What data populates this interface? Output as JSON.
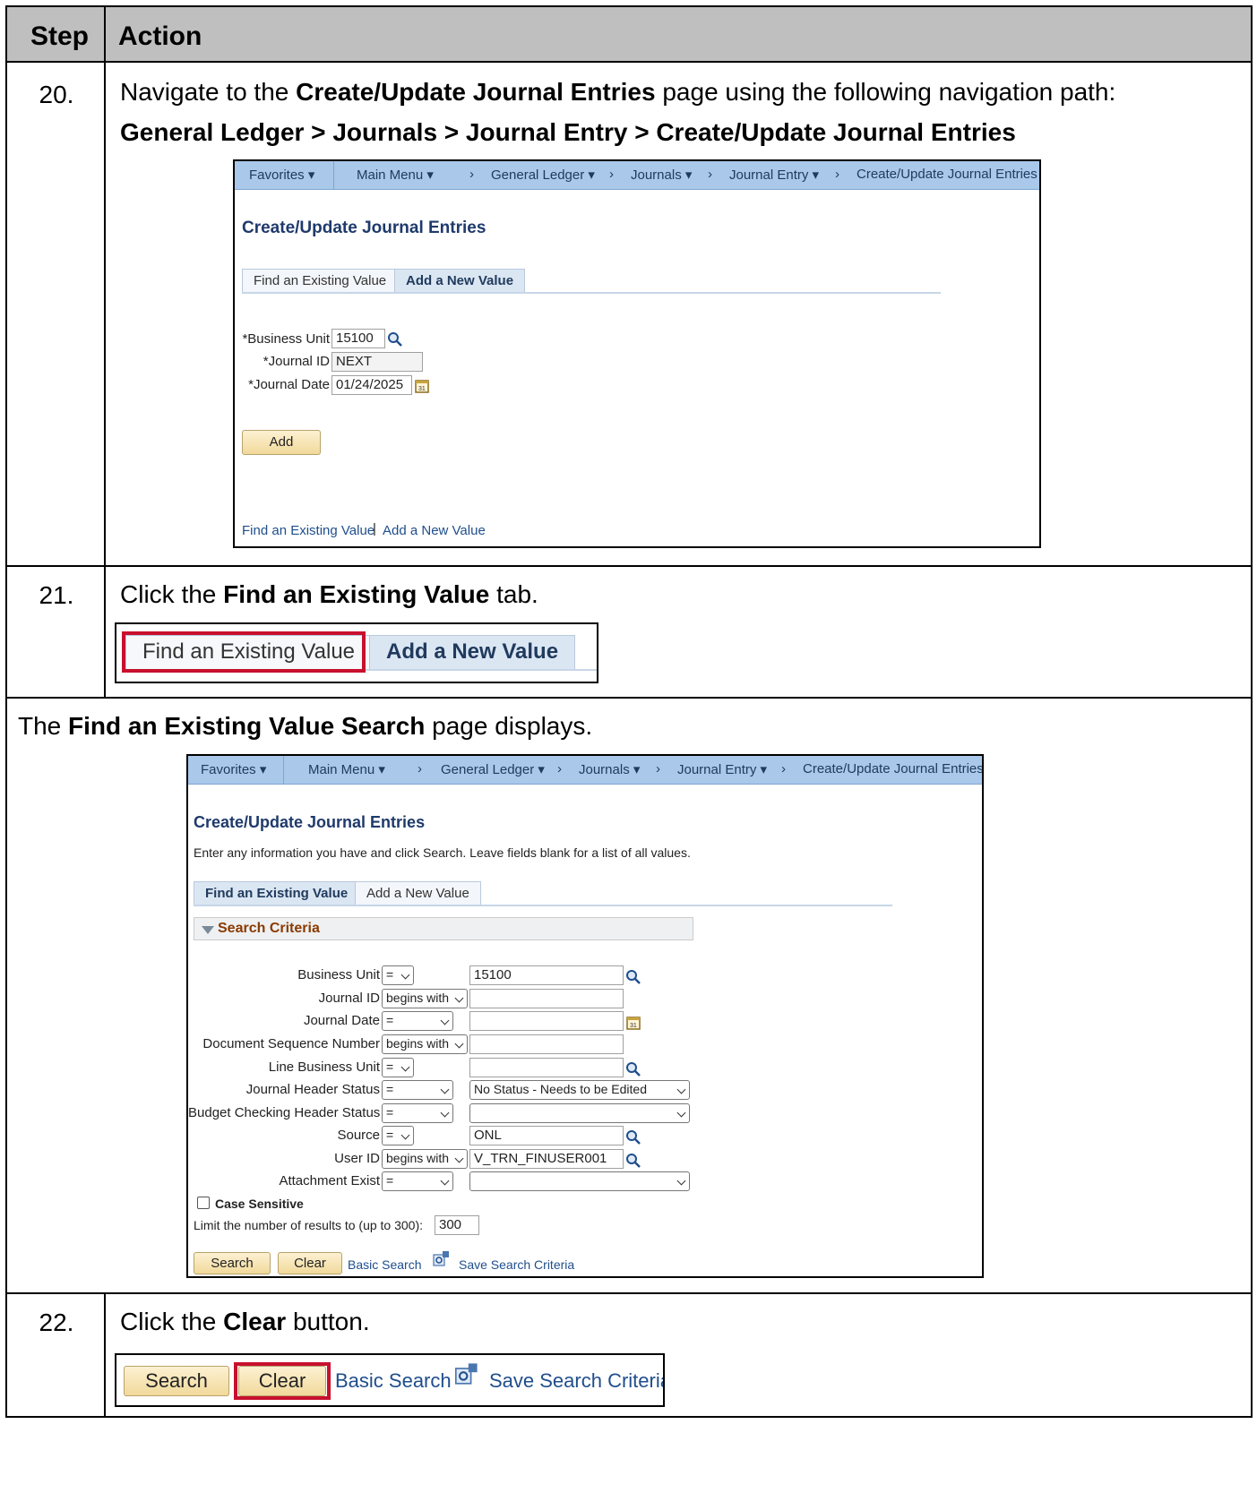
{
  "table_header": {
    "step": "Step",
    "action": "Action"
  },
  "nav": {
    "favorites": "Favorites",
    "main_menu": "Main Menu",
    "general_ledger": "General Ledger",
    "journals": "Journals",
    "journal_entry": "Journal Entry",
    "page": "Create/Update Journal Entries",
    "sep": ">"
  },
  "step20": {
    "num": "20.",
    "t1": "Navigate to the ",
    "b1": "Create/Update Journal Entries",
    "t2": " page using the following navigation path:",
    "path": "General Ledger > Journals > Journal Entry > Create/Update Journal Entries",
    "page_title": "Create/Update Journal Entries",
    "tab_find": "Find an Existing Value",
    "tab_add": "Add a New Value",
    "bu_label": "*Business Unit",
    "bu_value": "15100",
    "jid_label": "*Journal ID",
    "jid_value": "NEXT",
    "jdate_label": "*Journal Date",
    "jdate_value": "01/24/2025",
    "add_button": "Add",
    "link_find": "Find an Existing Value",
    "link_sep": "|",
    "link_add": "Add a New Value"
  },
  "step21": {
    "num": "21.",
    "t1": "Click the ",
    "b1": "Find an Existing Value",
    "t2": " tab.",
    "tab_find": "Find an Existing Value",
    "tab_add": "Add a New Value"
  },
  "note": {
    "t1": "The ",
    "b1": "Find an Existing Value Search",
    "t2": " page displays."
  },
  "search_page": {
    "title": "Create/Update Journal Entries",
    "instructions": "Enter any information you have and click Search. Leave fields blank for a list of all values.",
    "tab_find": "Find an Existing Value",
    "tab_add": "Add a New Value",
    "criteria_header": "Search Criteria",
    "fields": [
      {
        "label": "Business Unit",
        "op": "=",
        "value": "15100"
      },
      {
        "label": "Journal ID",
        "op": "begins with",
        "value": ""
      },
      {
        "label": "Journal Date",
        "op": "=",
        "value": ""
      },
      {
        "label": "Document Sequence Number",
        "op": "begins with",
        "value": ""
      },
      {
        "label": "Line Business Unit",
        "op": "=",
        "value": ""
      },
      {
        "label": "Journal Header Status",
        "op": "=",
        "value": "No Status - Needs to be Edited"
      },
      {
        "label": "Budget Checking Header Status",
        "op": "=",
        "value": ""
      },
      {
        "label": "Source",
        "op": "=",
        "value": "ONL"
      },
      {
        "label": "User ID",
        "op": "begins with",
        "value": "V_TRN_FINUSER001"
      },
      {
        "label": "Attachment Exist",
        "op": "=",
        "value": ""
      }
    ],
    "case_sensitive": "Case Sensitive",
    "limit_label": "Limit the number of results to (up to 300):",
    "limit_value": "300",
    "search_button": "Search",
    "clear_button": "Clear",
    "basic_search": "Basic Search",
    "save_search": "Save Search Criteria"
  },
  "step22": {
    "num": "22.",
    "t1": "Click the ",
    "b1": "Clear",
    "t2": " button.",
    "search_button": "Search",
    "clear_button": "Clear",
    "basic_search": "Basic Search",
    "save_search": "Save Search Criteria"
  },
  "colors": {
    "highlight": "#c8102e",
    "header_bg": "#bfbfbf",
    "nav_bg": "#a9c8ea",
    "button_bg": "#f1d99b"
  }
}
